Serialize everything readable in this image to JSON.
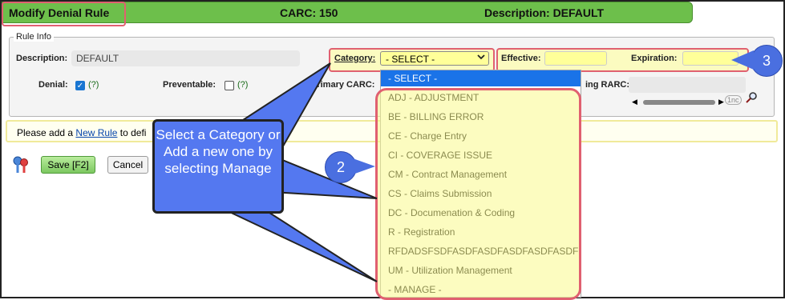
{
  "header": {
    "title": "Modify Denial Rule",
    "carc": "CARC: 150",
    "description": "Description: DEFAULT"
  },
  "rule_info": {
    "legend": "Rule Info",
    "description_label": "Description:",
    "description_value": "DEFAULT",
    "category_label": "Category:",
    "category_selected": "- SELECT -",
    "effective_label": "Effective:",
    "expiration_label": "Expiration:",
    "denial_label": "Denial:",
    "denial_checked": true,
    "help": "(?)",
    "preventable_label": "Preventable:",
    "preventable_checked": false,
    "primary_carc_label": "Primary CARC:",
    "rarc_label": "ing RARC:",
    "scroll_hint": "1nc"
  },
  "info_bar": {
    "prefix": "Please add a",
    "link": "New Rule",
    "suffix": "to defi"
  },
  "buttons": {
    "save": "Save [F2]",
    "cancel": "Cancel"
  },
  "dropdown": {
    "options": [
      "- SELECT -",
      "ADJ - ADJUSTMENT",
      "BE - BILLING ERROR",
      "CE - Charge Entry",
      "CI - COVERAGE ISSUE",
      "CM - Contract Management",
      "CS - Claims Submission",
      "DC - Documenation & Coding",
      "R - Registration",
      "RFDADSFSDFASDFASDFASDFASDFASDF",
      "UM - Utilization Management",
      "- MANAGE -"
    ],
    "selected_index": 0
  },
  "callouts": {
    "main_text": "Select a Category or Add a new one by selecting Manage",
    "num2": "2",
    "num3": "3"
  },
  "colors": {
    "header_green": "#6dbf4b",
    "highlight_red": "#e06070",
    "callout_blue": "#5478f0",
    "select_yellow": "#ffff99"
  }
}
